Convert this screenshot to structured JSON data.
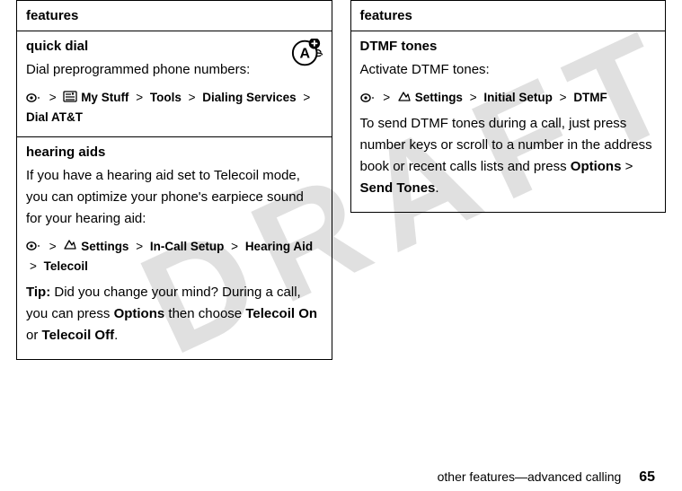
{
  "watermark": "DRAFT",
  "left": {
    "header": "features",
    "quickdial": {
      "title": "quick dial",
      "body": "Dial preprogrammed phone numbers:",
      "nav_mystuff": "My Stuff",
      "nav_tools": "Tools",
      "nav_dialing": "Dialing Services",
      "nav_dialatt": "Dial AT&T"
    },
    "hearing": {
      "title": "hearing aids",
      "body": "If you have a hearing aid set to Telecoil mode, you can optimize your phone's earpiece sound for your hearing aid:",
      "nav_settings": "Settings",
      "nav_incall": "In-Call Setup",
      "nav_hearing": "Hearing Aid",
      "nav_telecoil": "Telecoil",
      "tip_label": "Tip:",
      "tip_pre": " Did you change your mind? During a call, you can press ",
      "tip_options": "Options",
      "tip_mid": " then choose ",
      "tip_on": "Telecoil On",
      "tip_or": " or ",
      "tip_off": "Telecoil Off",
      "tip_end": "."
    }
  },
  "right": {
    "header": "features",
    "dtmf": {
      "title": "DTMF tones",
      "body1": "Activate DTMF tones:",
      "nav_settings": "Settings",
      "nav_initial": "Initial Setup",
      "nav_dtmf": "DTMF",
      "body2_pre": "To send DTMF tones during a call, just press number keys or scroll to a number in the address book or recent calls lists and press ",
      "body2_options": "Options",
      "body2_gt": " > ",
      "body2_send": "Send Tones",
      "body2_end": "."
    }
  },
  "footer": {
    "section": "other features—advanced calling",
    "page": "65"
  }
}
